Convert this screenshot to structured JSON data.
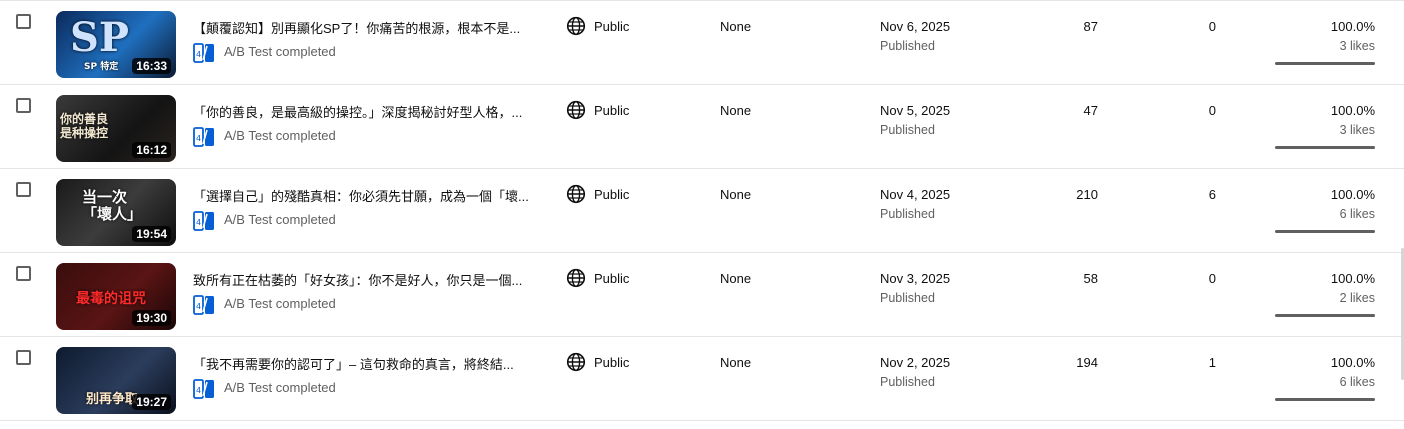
{
  "ab_label": "A/B Test completed",
  "rows": [
    {
      "title": "【顛覆認知】別再顯化SP了！你痛苦的根源，根本不是...",
      "duration": "16:33",
      "thumb_text": "SP",
      "thumb_sub": "SP 特定",
      "visibility": "Public",
      "restrictions": "None",
      "date": "Nov 6, 2025",
      "status": "Published",
      "views": "87",
      "comments": "0",
      "like_pct": "100.0%",
      "likes": "3 likes",
      "like_ratio": 1.0
    },
    {
      "title": "「你的善良，是最高級的操控。」深度揭秘討好型人格，...",
      "duration": "16:12",
      "thumb_text": "你的善良\n是种操控",
      "visibility": "Public",
      "restrictions": "None",
      "date": "Nov 5, 2025",
      "status": "Published",
      "views": "47",
      "comments": "0",
      "like_pct": "100.0%",
      "likes": "3 likes",
      "like_ratio": 1.0
    },
    {
      "title": "「選擇自己」的殘酷真相：你必須先甘願，成為一個「壞...",
      "duration": "19:54",
      "thumb_text": "当一次\n「壞人」",
      "visibility": "Public",
      "restrictions": "None",
      "date": "Nov 4, 2025",
      "status": "Published",
      "views": "210",
      "comments": "6",
      "like_pct": "100.0%",
      "likes": "6 likes",
      "like_ratio": 1.0
    },
    {
      "title": "致所有正在枯萎的「好女孩」：你不是好人，你只是一個...",
      "duration": "19:30",
      "thumb_text": "最毒的诅咒",
      "visibility": "Public",
      "restrictions": "None",
      "date": "Nov 3, 2025",
      "status": "Published",
      "views": "58",
      "comments": "0",
      "like_pct": "100.0%",
      "likes": "2 likes",
      "like_ratio": 1.0
    },
    {
      "title": "「我不再需要你的認可了」– 這句救命的真言，將終結...",
      "duration": "19:27",
      "thumb_text": "别再争取",
      "visibility": "Public",
      "restrictions": "None",
      "date": "Nov 2, 2025",
      "status": "Published",
      "views": "194",
      "comments": "1",
      "like_pct": "100.0%",
      "likes": "6 likes",
      "like_ratio": 1.0
    }
  ]
}
